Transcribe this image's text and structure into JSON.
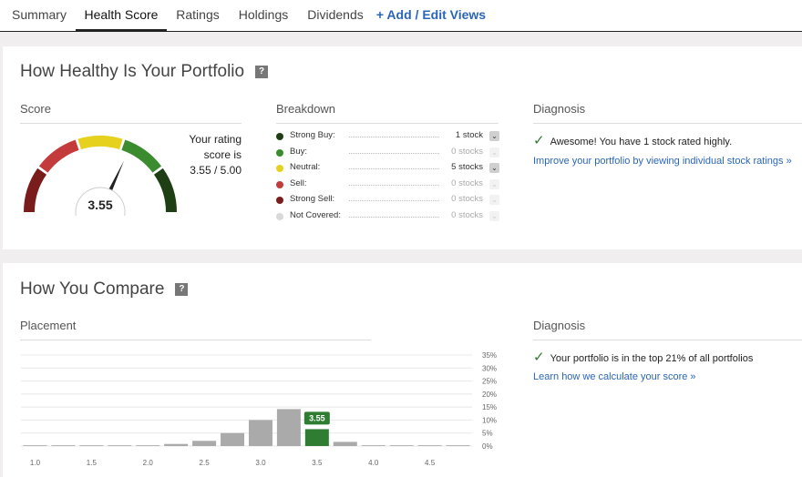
{
  "tabs": [
    {
      "label": "Summary"
    },
    {
      "label": "Health Score"
    },
    {
      "label": "Ratings"
    },
    {
      "label": "Holdings"
    },
    {
      "label": "Dividends"
    },
    {
      "label": "+ Add / Edit Views"
    }
  ],
  "health": {
    "title": "How Healthy Is Your Portfolio",
    "help": "?",
    "score_header": "Score",
    "score_value": "3.55",
    "score_numeric": 3.55,
    "rating_line1": "Your rating",
    "rating_line2": "score is",
    "rating_line3": "3.55 / 5.00",
    "breakdown_header": "Breakdown",
    "breakdown": [
      {
        "label": "Strong Buy:",
        "value": "1 stock",
        "color": "#1e3f14",
        "active": true
      },
      {
        "label": "Buy:",
        "value": "0 stocks",
        "color": "#3b8b2f",
        "active": false
      },
      {
        "label": "Neutral:",
        "value": "5 stocks",
        "color": "#e6d21e",
        "active": true
      },
      {
        "label": "Sell:",
        "value": "0 stocks",
        "color": "#c43b3b",
        "active": false
      },
      {
        "label": "Strong Sell:",
        "value": "0 stocks",
        "color": "#7a1c1c",
        "active": false
      },
      {
        "label": "Not Covered:",
        "value": "0 stocks",
        "color": "#d9d9d9",
        "active": false
      }
    ],
    "diagnosis_header": "Diagnosis",
    "diagnosis_text": "Awesome! You have 1 stock rated highly.",
    "diagnosis_link": "Improve your portfolio by viewing individual stock ratings »"
  },
  "compare": {
    "title": "How You Compare",
    "help": "?",
    "placement_header": "Placement",
    "diagnosis_header": "Diagnosis",
    "diagnosis_text": "Your portfolio is in the top 21% of all portfolios",
    "diagnosis_link": "Learn how we calculate your score »"
  },
  "chart_data": {
    "type": "bar",
    "x": [
      1.0,
      1.25,
      1.5,
      1.75,
      2.0,
      2.25,
      2.5,
      2.75,
      3.0,
      3.25,
      3.5,
      3.75,
      4.0,
      4.25,
      4.5,
      4.75
    ],
    "values": [
      0.3,
      0.3,
      0.3,
      0.3,
      0.3,
      0.8,
      2.0,
      5.0,
      10.0,
      14.2,
      6.5,
      1.6,
      0.3,
      0.3,
      0.3,
      0.3
    ],
    "highlight_index": 10,
    "highlight_label": "3.55",
    "x_ticks": [
      "1.0",
      "1.5",
      "2.0",
      "2.5",
      "3.0",
      "3.5",
      "4.0",
      "4.5"
    ],
    "y_ticks": [
      "35%",
      "30%",
      "25%",
      "20%",
      "15%",
      "10%",
      "5%",
      "0%"
    ],
    "ylim": [
      0,
      35
    ],
    "grid": true,
    "bar_color": "#aaaaaa",
    "highlight_color": "#2e7d32"
  }
}
